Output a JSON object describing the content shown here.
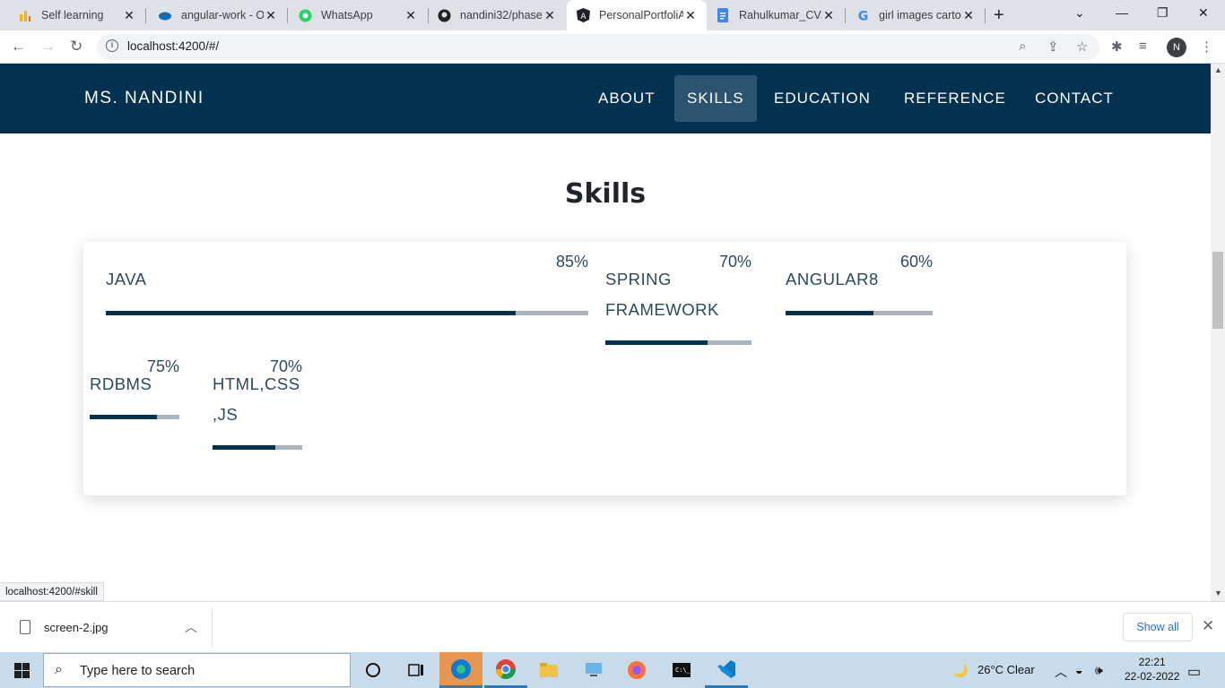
{
  "browser": {
    "tabs": [
      {
        "title": "Self learning",
        "icon": "bar-chart-icon"
      },
      {
        "title": "angular-work - O",
        "icon": "onedrive-icon"
      },
      {
        "title": "WhatsApp",
        "icon": "whatsapp-icon"
      },
      {
        "title": "nandini32/phase",
        "icon": "github-icon"
      },
      {
        "title": "PersonalPortfoliA",
        "icon": "angular-icon",
        "active": true
      },
      {
        "title": "Rahulkumar_CV.d",
        "icon": "docs-icon"
      },
      {
        "title": "girl images carto",
        "icon": "google-icon"
      }
    ],
    "new_tab": "+",
    "url": "localhost:4200/#/",
    "profile_initial": "N",
    "status_url": "localhost:4200/#skill"
  },
  "site": {
    "brand": "MS. NANDINI",
    "nav": [
      "ABOUT",
      "SKILLS",
      "EDUCATION",
      "REFERENCE",
      "CONTACT"
    ],
    "active_nav": "SKILLS",
    "section_title": "Skills",
    "skills": [
      {
        "name": "JAVA",
        "percent_label": "85%",
        "level": 0.85
      },
      {
        "name": "SPRING FRAMEWORK",
        "percent_label": "70%",
        "level": 0.7
      },
      {
        "name": "ANGULAR8",
        "percent_label": "60%",
        "level": 0.6
      },
      {
        "name": "RDBMS",
        "percent_label": "75%",
        "level": 0.75
      },
      {
        "name": "HTML,CSS ,JS",
        "percent_label": "70%",
        "level": 0.7
      }
    ],
    "colors": {
      "navbar": "#033150",
      "bar_fill": "#033150",
      "bar_track": "#a9b4bd",
      "active_nav": "#2a5470"
    }
  },
  "downloads": {
    "file_name": "screen-2.jpg",
    "show_all": "Show all"
  },
  "taskbar": {
    "search_placeholder": "Type here to search",
    "weather": "26°C  Clear",
    "time": "22:21",
    "date": "22-02-2022"
  }
}
